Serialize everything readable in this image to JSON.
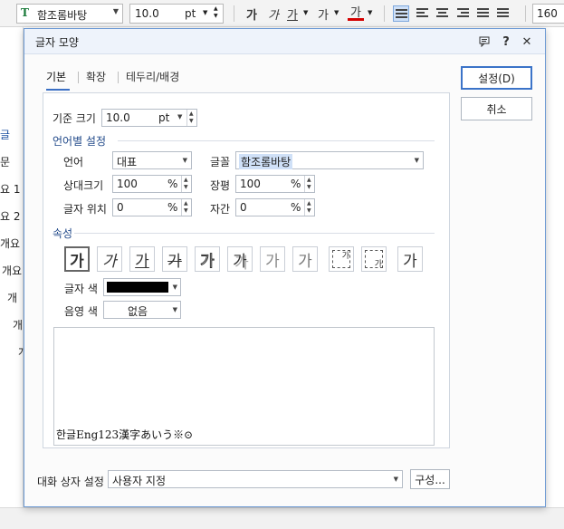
{
  "toolbar": {
    "font_name": "함조롬바탕",
    "font_icon": "T",
    "font_size": "10.0",
    "font_unit": "pt",
    "bold": "가",
    "italic": "가",
    "underline": "가",
    "strike": "가",
    "font_color": "가",
    "line_spacing": "160"
  },
  "left_panel": {
    "items": [
      "글",
      "문",
      "요 1",
      "요 2",
      "개요",
      "개요",
      "개",
      "개",
      "개"
    ]
  },
  "dialog": {
    "title": "글자 모양",
    "tabs": [
      "기본",
      "확장",
      "테두리/배경"
    ],
    "base_size_label": "기준 크기",
    "base_size_value": "10.0",
    "base_size_unit": "pt",
    "lang_section": "언어별 설정",
    "language_label": "언어",
    "language_value": "대표",
    "font_label": "글꼴",
    "font_value": "함조롬바탕",
    "relative_size_label": "상대크기",
    "relative_size_value": "100",
    "width_label": "장평",
    "width_value": "100",
    "position_label": "글자 위치",
    "position_value": "0",
    "spacing_label": "자간",
    "spacing_value": "0",
    "percent": "%",
    "attr_section": "속성",
    "attr_buttons": [
      "가",
      "가",
      "가",
      "가",
      "가",
      "가",
      "가",
      "가",
      "가",
      "가",
      "가"
    ],
    "text_color_label": "글자 색",
    "shade_color_label": "음영 색",
    "shade_color_value": "없음",
    "preview_text": "한글Eng123漢字あいう※⊙",
    "ok_button": "설정(D)",
    "cancel_button": "취소",
    "dialog_setting_label": "대화 상자 설정",
    "dialog_setting_value": "사용자 지정",
    "config_button": "구성..."
  },
  "colors": {
    "accent": "#3b73c8",
    "text_color": "#000000",
    "title_bar": "#eef3fb"
  }
}
